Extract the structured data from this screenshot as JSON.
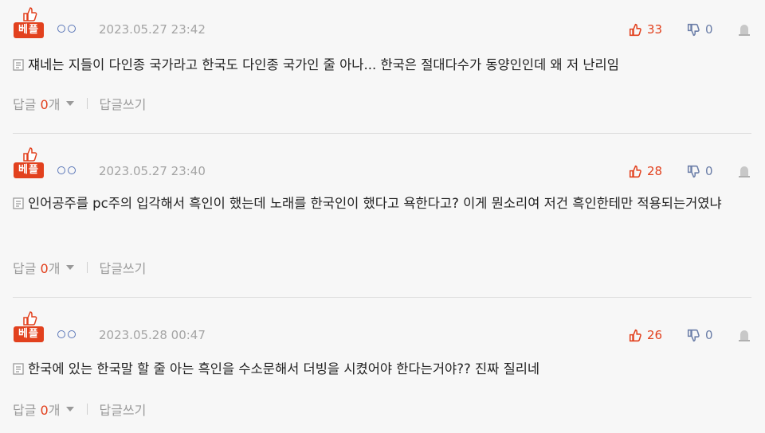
{
  "best_badge": "베플",
  "reply_label": "답글",
  "reply_unit": "개",
  "write_reply_label": "답글쓰기",
  "colors": {
    "accent": "#e2411e",
    "down": "#6b7ea8",
    "muted": "#a4a4a4",
    "circle": "#5b77b8"
  },
  "comments": [
    {
      "date": "2023.05.27 23:42",
      "text": "쟤네는 지들이 다인종 국가라고 한국도 다인종 국가인 줄 아나... 한국은 절대다수가 동양인인데 왜 저 난리임",
      "up": "33",
      "down": "0",
      "reply_count": "0"
    },
    {
      "date": "2023.05.27 23:40",
      "text": "인어공주를 pc주의 입각해서 흑인이 했는데 노래를 한국인이 했다고 욕한다고? 이게 뭔소리여 저건 흑인한테만 적용되는거였냐",
      "up": "28",
      "down": "0",
      "reply_count": "0"
    },
    {
      "date": "2023.05.28 00:47",
      "text": "한국에 있는 한국말 할 줄 아는 흑인을 수소문해서 더빙을 시켰어야 한다는거야?? 진짜 질리네",
      "up": "26",
      "down": "0",
      "reply_count": "0"
    }
  ]
}
